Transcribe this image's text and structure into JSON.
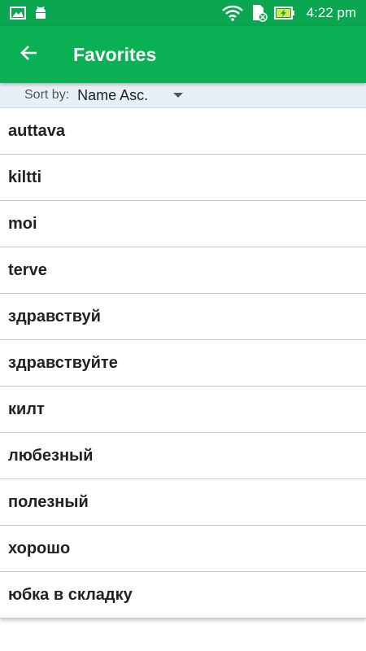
{
  "status_bar": {
    "time": "4:22 pm",
    "left_icons": [
      "image-icon",
      "android-icon"
    ],
    "right_icons": [
      "wifi-icon",
      "sd-card-icon",
      "battery-charging-icon"
    ]
  },
  "app_bar": {
    "title": "Favorites",
    "back_icon": "arrow-left-icon",
    "color": "#0ab054"
  },
  "sort": {
    "label": "Sort by:",
    "value": "Name Asc."
  },
  "favorites": [
    "auttava",
    "kiltti",
    "moi",
    "terve",
    "здравствуй",
    "здравствуйте",
    "килт",
    "любезный",
    "полезный",
    "хорошо",
    "юбка в складку"
  ]
}
